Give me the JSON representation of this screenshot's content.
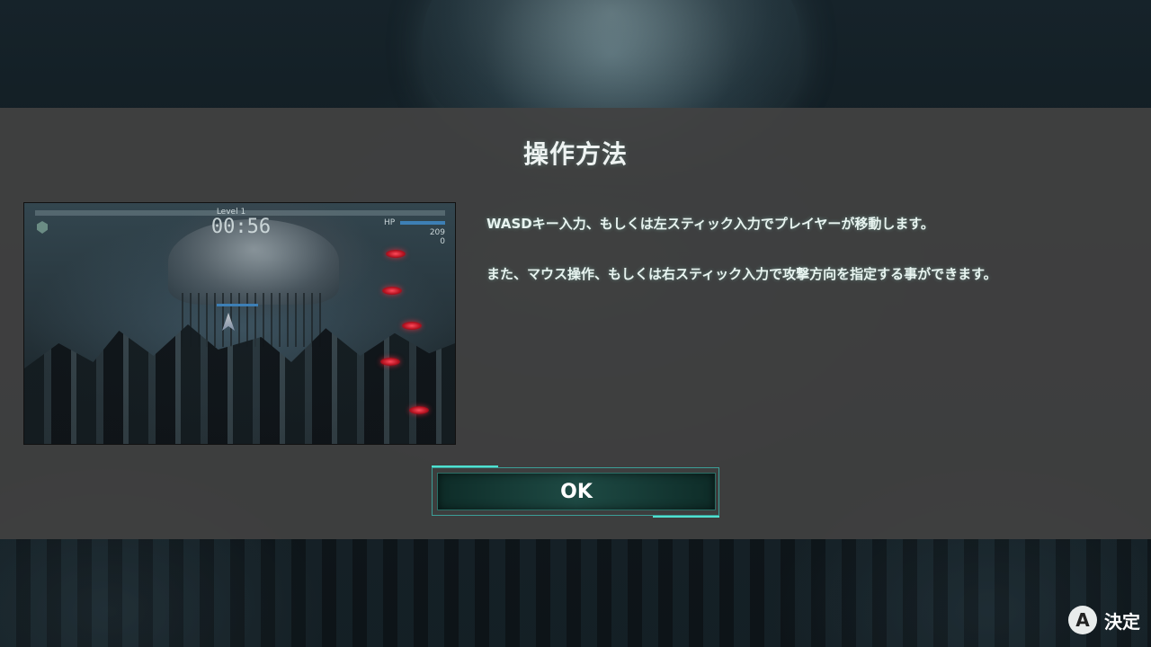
{
  "dialog": {
    "title": "操作方法",
    "lines": [
      "WASDキー入力、もしくは左スティック入力でプレイヤーが移動します。",
      "また、マウス操作、もしくは右スティック入力で攻撃方向を指定する事ができます。"
    ],
    "ok_label": "OK"
  },
  "preview": {
    "level": "Level 1",
    "timer": "00:56",
    "hp_label": "HP",
    "stat_1": "209",
    "stat_2": "0"
  },
  "hint": {
    "button_glyph": "A",
    "label": "決定"
  },
  "colors": {
    "accent": "#4fe0d0",
    "panel": "#424242",
    "enemy": "#e0283c"
  }
}
